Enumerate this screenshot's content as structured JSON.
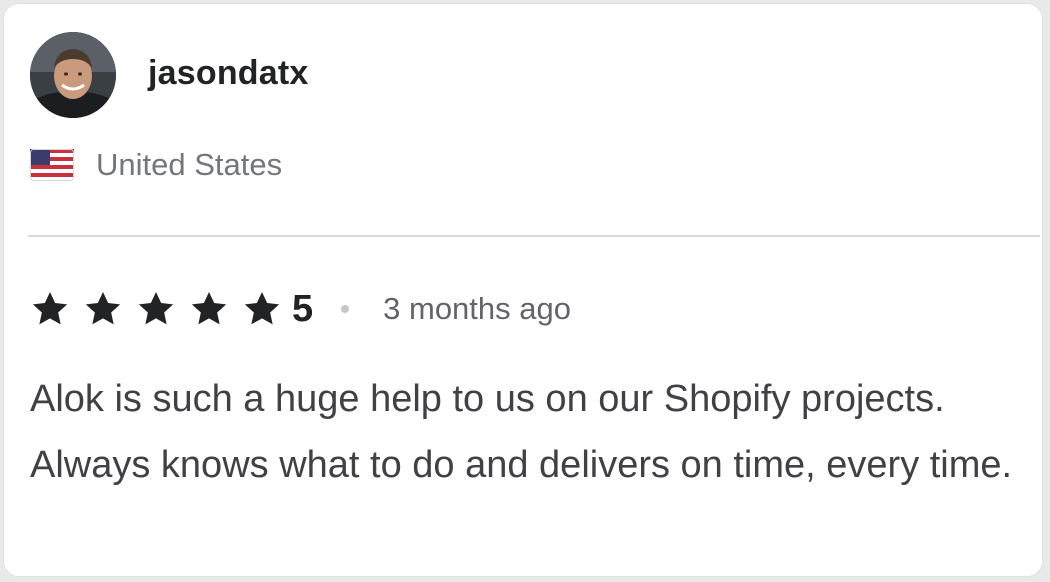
{
  "reviewer": {
    "username": "jasondatx",
    "country": "United States",
    "avatar": "reviewer-avatar-photo",
    "flag_icon": "us-flag-icon"
  },
  "rating": {
    "value": "5",
    "stars": 5,
    "max_stars": 5,
    "star_icon": "star-icon",
    "star_color": "#222325",
    "time_ago": "3 months ago"
  },
  "review": {
    "text": "Alok is such a huge help to us on our Shopify projects. Always knows what to do and delivers on time, every time."
  },
  "colors": {
    "primary_text": "#222325",
    "secondary_text": "#74767e",
    "body_text": "#404145",
    "divider": "#dadbdd"
  }
}
